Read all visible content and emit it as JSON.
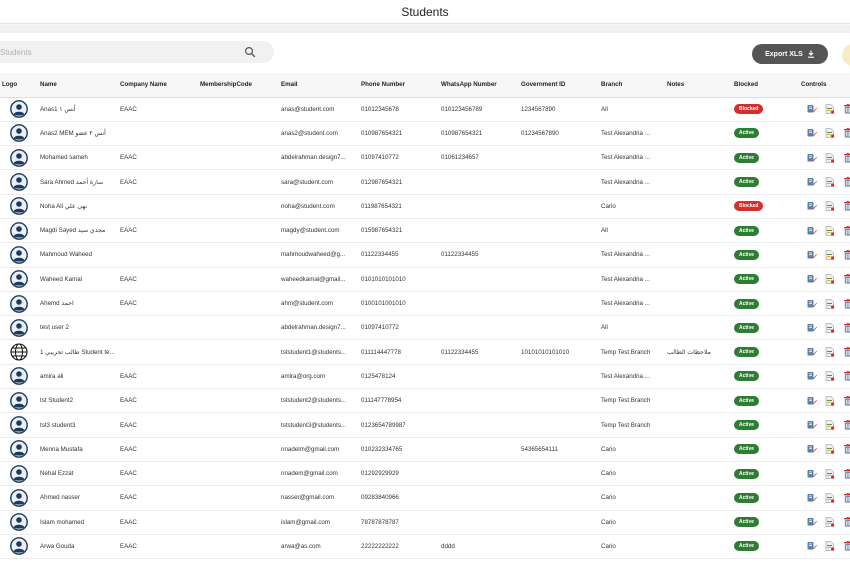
{
  "header": {
    "title": "Students"
  },
  "search": {
    "placeholder": "Students"
  },
  "toolbar": {
    "export_label": "Export XLS"
  },
  "colors": {
    "active": "#2e7d32",
    "blocked": "#d32f2f",
    "export_button": "#555555"
  },
  "table": {
    "columns": [
      "Logo",
      "Name",
      "Company Name",
      "MembershipCode",
      "Email",
      "Phone Number",
      "WhatsApp Number",
      "Government ID",
      "Branch",
      "Notes",
      "Blocked",
      "Controls"
    ],
    "rows": [
      {
        "logo": "avatar-icon",
        "name": "Anas1 أنس ١",
        "company": "EAAC",
        "membership": "",
        "email": "anas@student.com",
        "phone": "01012345678",
        "whatsapp": "010123456789",
        "gov_id": "1234567890",
        "branch": "All",
        "notes": "",
        "status": "Blocked"
      },
      {
        "logo": "avatar-icon",
        "name": "Anas2 MEM أنس ٢ عضو",
        "company": "",
        "membership": "",
        "email": "anas2@student.com",
        "phone": "010987654321",
        "whatsapp": "010987654321",
        "gov_id": "01234567890",
        "branch": "Test Alexandria ...",
        "notes": "",
        "status": "Active"
      },
      {
        "logo": "avatar-icon",
        "name": "Mohamed sameh",
        "company": "EAAC",
        "membership": "",
        "email": "abdelrahman.design7...",
        "phone": "01097410772",
        "whatsapp": "01061234657",
        "gov_id": "",
        "branch": "Test Alexandria ...",
        "notes": "",
        "status": "Active"
      },
      {
        "logo": "avatar-icon",
        "name": "Sara Ahmed سارة أحمد",
        "company": "EAAC",
        "membership": "",
        "email": "sara@student.com",
        "phone": "012987654321",
        "whatsapp": "",
        "gov_id": "",
        "branch": "Test Alexandria ...",
        "notes": "",
        "status": "Active"
      },
      {
        "logo": "avatar-icon",
        "name": "Noha Ali نهى علي",
        "company": "",
        "membership": "",
        "email": "noha@student.com",
        "phone": "011987654321",
        "whatsapp": "",
        "gov_id": "",
        "branch": "Cario",
        "notes": "",
        "status": "Blocked"
      },
      {
        "logo": "avatar-icon",
        "name": "Magdi Sayed مجدي سيد",
        "company": "EAAC",
        "membership": "",
        "email": "magdy@student.com",
        "phone": "015987654321",
        "whatsapp": "",
        "gov_id": "",
        "branch": "All",
        "notes": "",
        "status": "Active"
      },
      {
        "logo": "avatar-icon",
        "name": "Mahmoud Waheed",
        "company": "",
        "membership": "",
        "email": "mahmoudwaheed@g...",
        "phone": "01122334455",
        "whatsapp": "01122334455",
        "gov_id": "",
        "branch": "Test Alexandria ...",
        "notes": "",
        "status": "Active"
      },
      {
        "logo": "avatar-icon",
        "name": "Waheed Kamal",
        "company": "EAAC",
        "membership": "",
        "email": "waheedkamal@gmail...",
        "phone": "0101010101010",
        "whatsapp": "",
        "gov_id": "",
        "branch": "Test Alexandria ...",
        "notes": "",
        "status": "Active"
      },
      {
        "logo": "avatar-icon",
        "name": "Ahemd احمد",
        "company": "EAAC",
        "membership": "",
        "email": "ahm@student.com",
        "phone": "0100101001010",
        "whatsapp": "",
        "gov_id": "",
        "branch": "Test Alexandria ...",
        "notes": "",
        "status": "Active"
      },
      {
        "logo": "avatar-icon",
        "name": "test user 2",
        "company": "",
        "membership": "",
        "email": "abdelrahman.design7...",
        "phone": "01097410772",
        "whatsapp": "",
        "gov_id": "",
        "branch": "All",
        "notes": "",
        "status": "Active"
      },
      {
        "logo": "globe-icon",
        "name": "طالب تجريبي 1 Student te...",
        "company": "",
        "membership": "",
        "email": "tststudent1@students...",
        "phone": "011114447778",
        "whatsapp": "01122334455",
        "gov_id": "10101010101010",
        "branch": "Temp Test Branch",
        "notes": "ملاحظات الطالب",
        "status": "Active"
      },
      {
        "logo": "avatar-icon",
        "name": "amira ali",
        "company": "EAAC",
        "membership": "",
        "email": "amira@org.com",
        "phone": "0125478124",
        "whatsapp": "",
        "gov_id": "",
        "branch": "Test Alexandria ...",
        "notes": "",
        "status": "Active"
      },
      {
        "logo": "avatar-icon",
        "name": "tst Student2",
        "company": "EAAC",
        "membership": "",
        "email": "tststudent2@students...",
        "phone": "011147778954",
        "whatsapp": "",
        "gov_id": "",
        "branch": "Temp Test Branch",
        "notes": "",
        "status": "Active"
      },
      {
        "logo": "avatar-icon",
        "name": "tst3 student3",
        "company": "EAAC",
        "membership": "",
        "email": "tststudent3@students...",
        "phone": "0123654789987",
        "whatsapp": "",
        "gov_id": "",
        "branch": "Temp Test Branch",
        "notes": "",
        "status": "Active"
      },
      {
        "logo": "avatar-icon",
        "name": "Menna Mustafa",
        "company": "EAAC",
        "membership": "",
        "email": "nnadelm@gmail.com",
        "phone": "010232334765",
        "whatsapp": "",
        "gov_id": "54365654111",
        "branch": "Cario",
        "notes": "",
        "status": "Active"
      },
      {
        "logo": "avatar-icon",
        "name": "Nehal Ezzat",
        "company": "EAAC",
        "membership": "",
        "email": "nnadem@gmail.com",
        "phone": "01292929929",
        "whatsapp": "",
        "gov_id": "",
        "branch": "Cario",
        "notes": "",
        "status": "Active"
      },
      {
        "logo": "avatar-icon",
        "name": "Ahmed nasser",
        "company": "EAAC",
        "membership": "",
        "email": "nasser@gmail.com",
        "phone": "09283840966",
        "whatsapp": "",
        "gov_id": "",
        "branch": "Cario",
        "notes": "",
        "status": "Active"
      },
      {
        "logo": "avatar-icon",
        "name": "Islam mohamed",
        "company": "EAAC",
        "membership": "",
        "email": "islam@gmail.com",
        "phone": "78787878787",
        "whatsapp": "",
        "gov_id": "",
        "branch": "Cario",
        "notes": "",
        "status": "Active"
      },
      {
        "logo": "avatar-icon",
        "name": "Arwa Gouda",
        "company": "EAAC",
        "membership": "",
        "email": "arwa@as.com",
        "phone": "22222222222",
        "whatsapp": "dddd",
        "gov_id": "",
        "branch": "Cario",
        "notes": "",
        "status": "Active"
      }
    ]
  }
}
